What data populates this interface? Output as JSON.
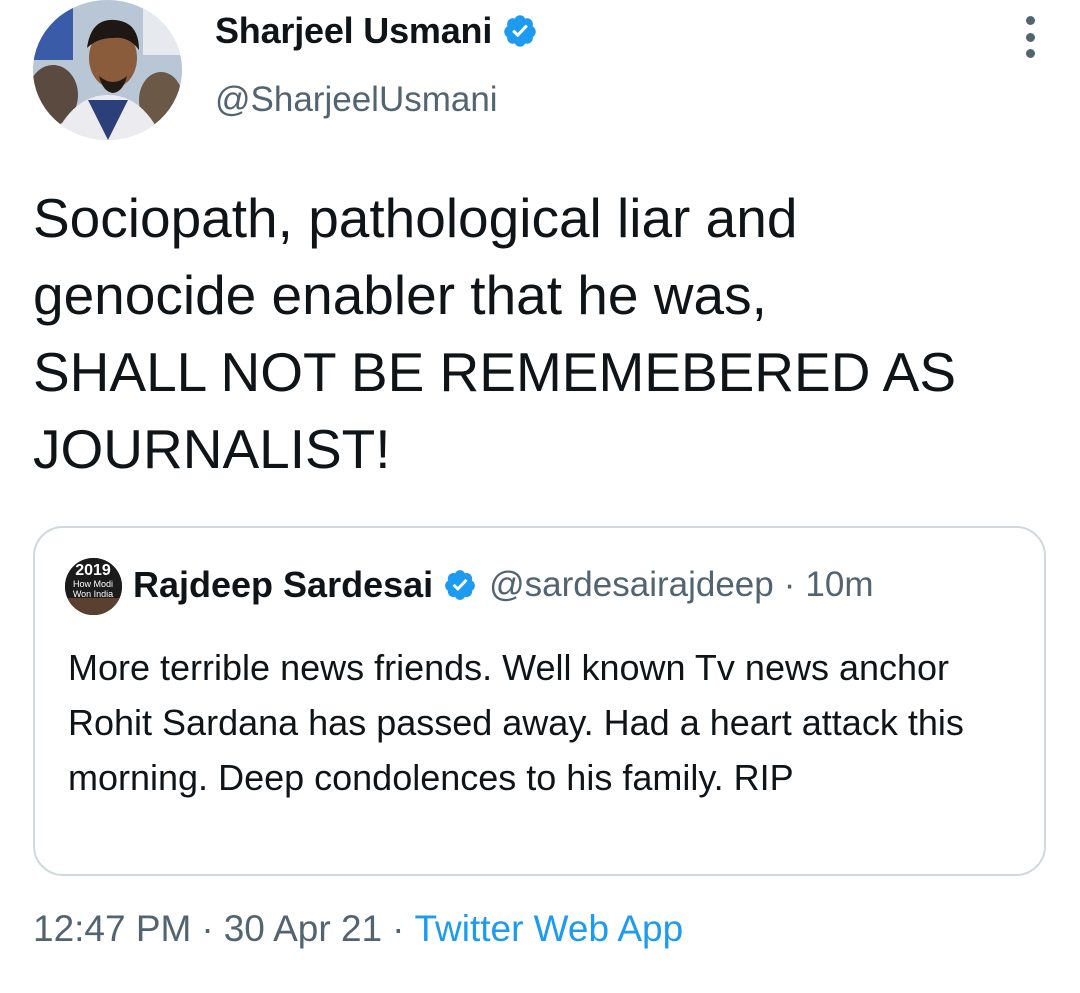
{
  "author": {
    "display_name": "Sharjeel Usmani",
    "handle": "@SharjeelUsmani",
    "verified_icon": "verified-badge-icon",
    "avatar_icon": "profile-photo"
  },
  "tweet": {
    "text": "Sociopath, pathological liar and\ngenocide enabler that he was,\nSHALL NOT BE REMEMEBERED AS\nJOURNALIST!"
  },
  "quoted_tweet": {
    "display_name": "Rajdeep Sardesai",
    "handle": "@sardesairajdeep",
    "separator": "·",
    "time": "10m",
    "text": "More terrible news friends. Well known Tv news anchor Rohit Sardana has passed away. Had a heart attack this morning. Deep condolences to his family. RIP",
    "avatar_text": [
      "2019",
      "How Modi",
      "Won India"
    ]
  },
  "meta": {
    "time": "12:47 PM",
    "separator": "·",
    "date": "30 Apr 21",
    "source": "Twitter Web App"
  },
  "colors": {
    "accent": "#1d9bf0",
    "secondary_text": "#536471",
    "border": "#cfd9de"
  }
}
